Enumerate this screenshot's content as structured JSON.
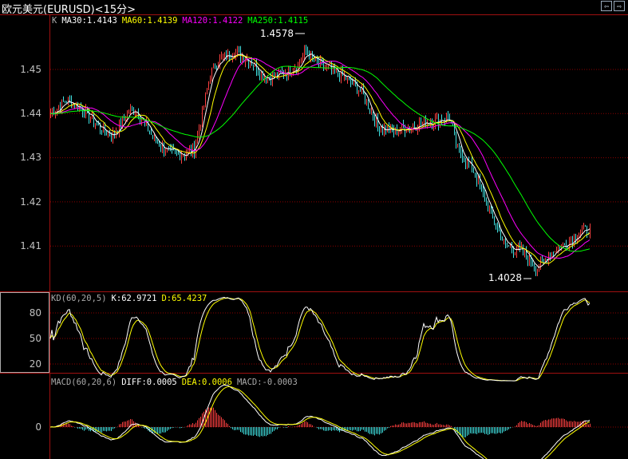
{
  "window": {
    "title": "欧元美元(EURUSD)<15分>",
    "nav_prev": "⇦",
    "nav_next": "⇨"
  },
  "colors": {
    "grid": "#8b0000",
    "up": "#ff4040",
    "down": "#40e0e0",
    "ma30": "#ffffff",
    "ma60": "#ffff00",
    "ma120": "#ff00ff",
    "ma250": "#00ff00",
    "k": "#ffffff",
    "d": "#ffff00"
  },
  "main": {
    "k_label": "K",
    "ma30": "MA30:1.4143",
    "ma60": "MA60:1.4139",
    "ma120": "MA120:1.4122",
    "ma250": "MA250:1.4115",
    "high_label": "1.4578",
    "low_label": "1.4028",
    "y_ticks": [
      "1.45",
      "1.44",
      "1.43",
      "1.42",
      "1.41"
    ]
  },
  "kd": {
    "name": "KD(60,20,5)",
    "k": "K:62.9721",
    "d": "D:65.4237",
    "y_ticks": [
      "80",
      "50",
      "20"
    ]
  },
  "macd": {
    "name": "MACD(60,20,6)",
    "diff": "DIFF:0.0005",
    "dea": "DEA:0.0006",
    "macd": "MACD:-0.0003",
    "y_ticks": [
      "0"
    ]
  },
  "chart_data": {
    "type": "candlestick",
    "interval": "15分",
    "symbol": "EURUSD",
    "ylim": [
      1.402,
      1.459
    ],
    "high": 1.4578,
    "low": 1.4028,
    "close_path": [
      [
        0,
        1.44
      ],
      [
        10,
        1.443
      ],
      [
        20,
        1.441
      ],
      [
        30,
        1.437
      ],
      [
        38,
        1.435
      ],
      [
        45,
        1.438
      ],
      [
        50,
        1.441
      ],
      [
        55,
        1.44
      ],
      [
        65,
        1.434
      ],
      [
        75,
        1.431
      ],
      [
        85,
        1.431
      ],
      [
        90,
        1.432
      ],
      [
        95,
        1.44
      ],
      [
        100,
        1.449
      ],
      [
        105,
        1.452
      ],
      [
        115,
        1.454
      ],
      [
        125,
        1.452
      ],
      [
        135,
        1.448
      ],
      [
        145,
        1.449
      ],
      [
        155,
        1.451
      ],
      [
        160,
        1.454
      ],
      [
        165,
        1.452
      ],
      [
        175,
        1.45
      ],
      [
        185,
        1.448
      ],
      [
        195,
        1.445
      ],
      [
        205,
        1.437
      ],
      [
        215,
        1.436
      ],
      [
        225,
        1.437
      ],
      [
        235,
        1.438
      ],
      [
        250,
        1.439
      ],
      [
        255,
        1.432
      ],
      [
        265,
        1.427
      ],
      [
        275,
        1.418
      ],
      [
        285,
        1.41
      ],
      [
        295,
        1.409
      ],
      [
        305,
        1.405
      ],
      [
        315,
        1.409
      ],
      [
        325,
        1.411
      ],
      [
        330,
        1.413
      ],
      [
        338,
        1.414
      ]
    ]
  }
}
